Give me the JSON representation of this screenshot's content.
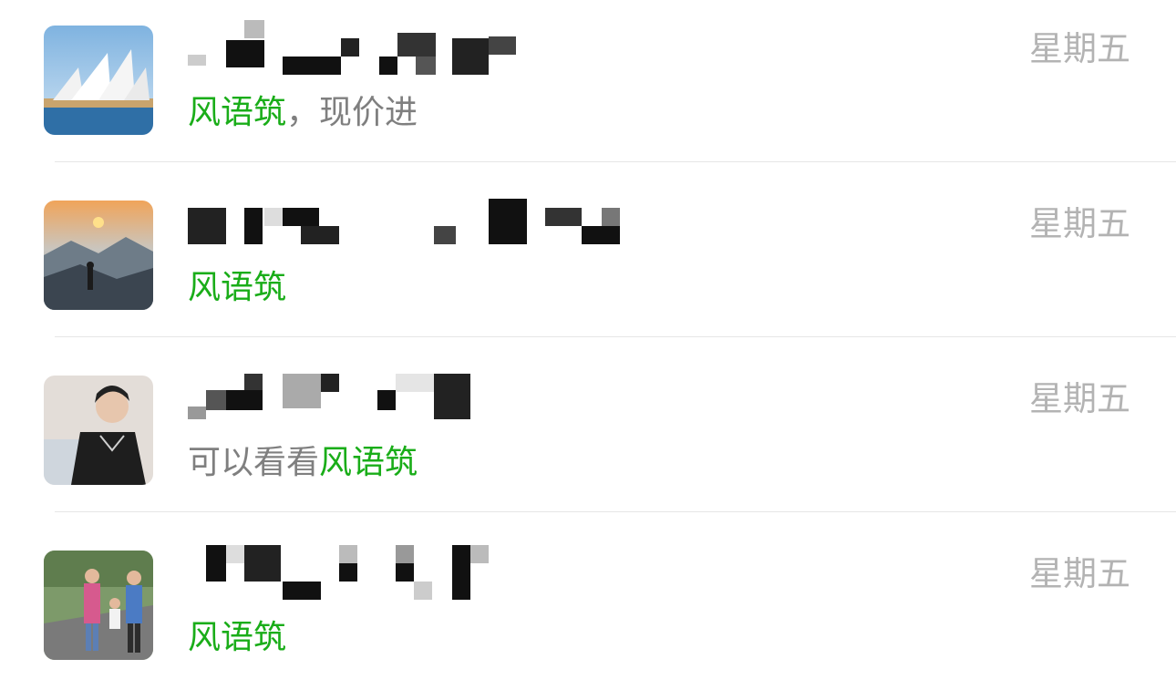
{
  "chats": [
    {
      "name": "风语筑",
      "time": "星期五",
      "preview_keyword": "风语筑",
      "preview_before": "",
      "preview_after": "，现价进",
      "avatar_icon": "opera-house-avatar"
    },
    {
      "name": "",
      "time": "星期五",
      "preview_keyword": "风语筑",
      "preview_before": "",
      "preview_after": "",
      "avatar_icon": "sunset-mountain-avatar"
    },
    {
      "name": "",
      "time": "星期五",
      "preview_keyword": "风语筑",
      "preview_before": "可以看看",
      "preview_after": "",
      "avatar_icon": "person-portrait-avatar"
    },
    {
      "name": "",
      "time": "星期五",
      "preview_keyword": "风语筑",
      "preview_before": "",
      "preview_after": "",
      "avatar_icon": "family-walk-avatar"
    }
  ],
  "colors": {
    "keyword_green": "#1aad19",
    "preview_gray": "#7f7f7f",
    "time_gray": "#b3b3b3",
    "divider": "#e6e6e6"
  }
}
